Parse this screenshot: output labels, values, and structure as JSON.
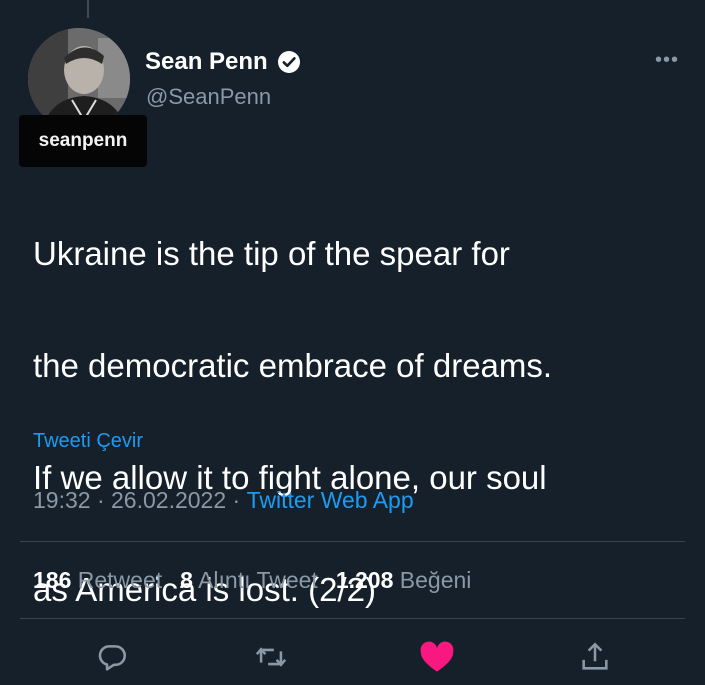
{
  "author": {
    "display_name": "Sean Penn",
    "handle": "@SeanPenn"
  },
  "watermark": "seanpenn",
  "tweet": {
    "lines": [
      "Ukraine is the tip of the spear for",
      "the democratic embrace of dreams.",
      "If we allow it to fight alone, our soul",
      "as America is lost. (2/2)"
    ]
  },
  "translate_label": "Tweeti Çevir",
  "meta": {
    "time": "19:32",
    "separator": " · ",
    "date": "26.02.2022",
    "source": "Twitter Web App"
  },
  "stats": {
    "retweets": {
      "count": "186",
      "label": "Retweet"
    },
    "quotes": {
      "count": "8",
      "label": "Alıntı Tweet"
    },
    "likes": {
      "count": "1.208",
      "label": "Beğeni"
    }
  },
  "actions": [
    "reply-icon",
    "retweet-icon",
    "like-icon",
    "share-icon"
  ],
  "colors": {
    "background": "#15202b",
    "accent": "#1d9bf0",
    "like": "#f91880",
    "muted": "#8b98a5"
  }
}
